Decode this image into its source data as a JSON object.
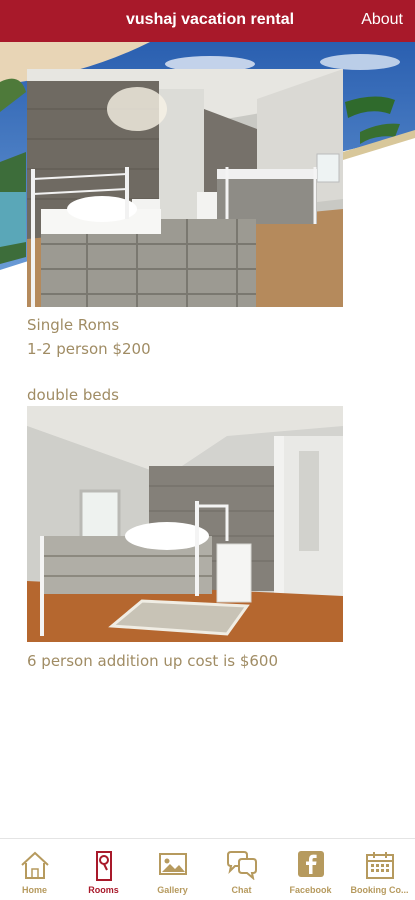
{
  "header": {
    "title": "vushaj vacation rental",
    "about_label": "About"
  },
  "rooms": [
    {
      "title": "Single Roms",
      "detail": "1-2 person $200"
    },
    {
      "title": "double beds",
      "detail": "6 person addition up cost is $600"
    }
  ],
  "bottom_nav": {
    "items": [
      {
        "label": "Home",
        "icon": "home-icon",
        "active": false
      },
      {
        "label": "Rooms",
        "icon": "door-hanger-icon",
        "active": true
      },
      {
        "label": "Gallery",
        "icon": "gallery-icon",
        "active": false
      },
      {
        "label": "Chat",
        "icon": "chat-icon",
        "active": false
      },
      {
        "label": "Facebook",
        "icon": "facebook-icon",
        "active": false
      },
      {
        "label": "Booking Co...",
        "icon": "calendar-icon",
        "active": false
      }
    ]
  },
  "colors": {
    "header_bg": "#a8192a",
    "caption_text": "#a08c64",
    "nav_icon": "#b69a5e",
    "nav_active": "#a8192a"
  }
}
